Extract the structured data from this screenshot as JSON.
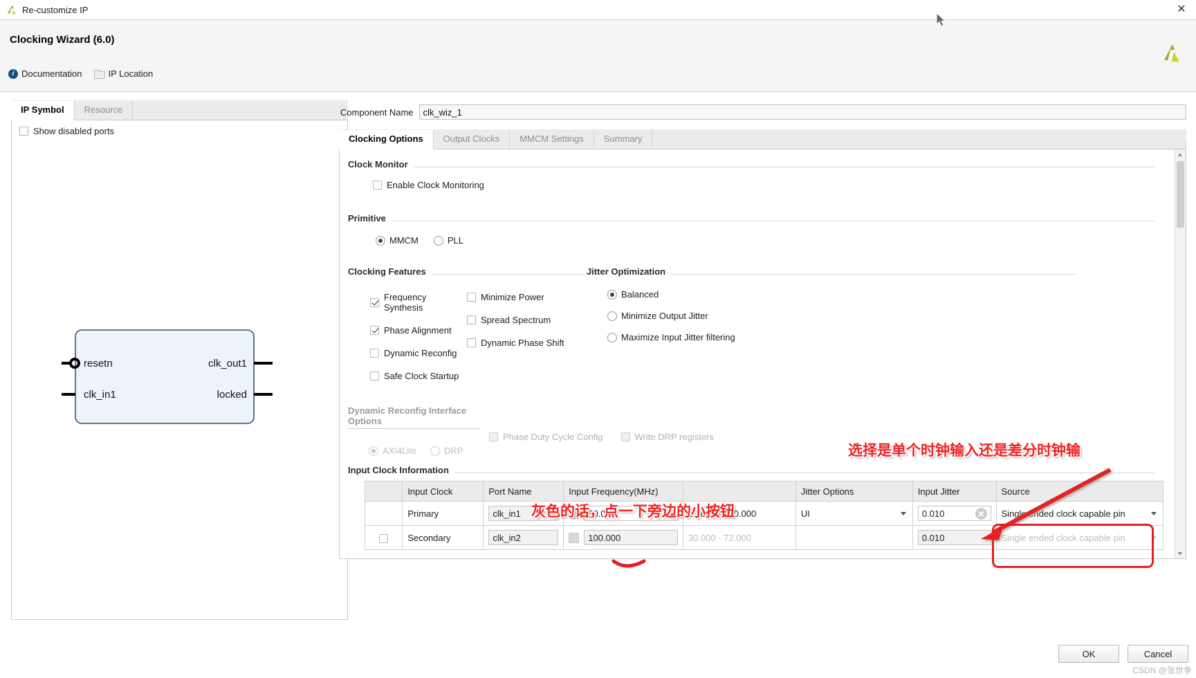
{
  "window": {
    "title": "Re-customize IP",
    "close_label": "✕",
    "logo_icon": "xilinx-logo-icon"
  },
  "header": {
    "title": "Clocking Wizard (6.0)",
    "links": [
      {
        "label": "Documentation",
        "icon": "info-icon"
      },
      {
        "label": "IP Location",
        "icon": "folder-icon"
      }
    ],
    "brand_logo": "xilinx-logo-icon"
  },
  "left_panel": {
    "tabs": [
      {
        "label": "IP Symbol",
        "active": true
      },
      {
        "label": "Resource",
        "active": false
      }
    ],
    "show_disabled_ports": {
      "label": "Show disabled ports",
      "checked": false
    },
    "symbol": {
      "inputs": [
        "resetn",
        "clk_in1"
      ],
      "outputs": [
        "clk_out1",
        "locked"
      ]
    }
  },
  "main": {
    "component_name": {
      "label": "Component Name",
      "value": "clk_wiz_1"
    },
    "tabs": [
      {
        "label": "Clocking Options",
        "active": true
      },
      {
        "label": "Output Clocks",
        "active": false
      },
      {
        "label": "MMCM Settings",
        "active": false
      },
      {
        "label": "Summary",
        "active": false
      }
    ],
    "clock_monitor": {
      "title": "Clock Monitor",
      "enable": {
        "label": "Enable Clock Monitoring",
        "checked": false
      }
    },
    "primitive": {
      "title": "Primitive",
      "options": [
        {
          "label": "MMCM",
          "selected": true
        },
        {
          "label": "PLL",
          "selected": false
        }
      ]
    },
    "clocking_features": {
      "title": "Clocking Features",
      "col1": [
        {
          "label": "Frequency Synthesis",
          "checked": true
        },
        {
          "label": "Phase Alignment",
          "checked": true
        },
        {
          "label": "Dynamic Reconfig",
          "checked": false
        },
        {
          "label": "Safe Clock Startup",
          "checked": false
        }
      ],
      "col2": [
        {
          "label": "Minimize Power",
          "checked": false
        },
        {
          "label": "Spread Spectrum",
          "checked": false
        },
        {
          "label": "Dynamic Phase Shift",
          "checked": false
        }
      ]
    },
    "jitter_optimization": {
      "title": "Jitter Optimization",
      "options": [
        {
          "label": "Balanced",
          "selected": true
        },
        {
          "label": "Minimize Output Jitter",
          "selected": false
        },
        {
          "label": "Maximize Input Jitter filtering",
          "selected": false
        }
      ]
    },
    "dynamic_reconfig": {
      "title": "Dynamic Reconfig Interface Options",
      "disabled": true,
      "radios": [
        {
          "label": "AXI4Lite",
          "selected": true
        },
        {
          "label": "DRP",
          "selected": false
        }
      ],
      "checkboxes": [
        {
          "label": "Phase Duty Cycle Config",
          "checked": false
        },
        {
          "label": "Write DRP registers",
          "checked": false
        }
      ]
    },
    "input_clock_information": {
      "title": "Input Clock Information",
      "columns": [
        "",
        "Input Clock",
        "Port Name",
        "Input Frequency(MHz)",
        "",
        "Jitter Options",
        "Input Jitter",
        "Source"
      ],
      "rows": [
        {
          "selected": true,
          "enabled_checkbox": false,
          "input_clock": "Primary",
          "port_name": "clk_in1",
          "frequency": "50.000",
          "range": "10.000 - 800.000",
          "jitter_options": "UI",
          "input_jitter": "0.010",
          "source": "Single ended clock capable pin",
          "dim": false
        },
        {
          "selected": false,
          "enabled_checkbox": true,
          "input_clock": "Secondary",
          "port_name": "clk_in2",
          "frequency": "100.000",
          "range": "30.000 - 72.000",
          "jitter_options": "",
          "input_jitter": "0.010",
          "source": "Single ended clock capable pin",
          "dim": true
        }
      ]
    }
  },
  "annotations": [
    {
      "text": "灰色的话，点一下旁边的小按钮",
      "color": "#ee2222"
    },
    {
      "text": "选择是单个时钟输入还是差分时钟输",
      "color": "#ee2222"
    }
  ],
  "footer": {
    "ok_label": "OK",
    "cancel_label": "Cancel"
  },
  "watermark": "CSDN @张世争"
}
